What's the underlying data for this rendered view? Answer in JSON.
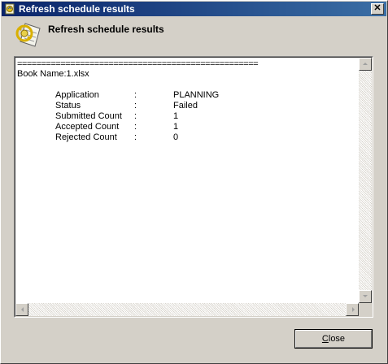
{
  "window": {
    "title": "Refresh schedule results",
    "close_glyph": "✕"
  },
  "header": {
    "title": "Refresh schedule results",
    "icon": "refresh-document-icon"
  },
  "results": {
    "separator": "==================================================",
    "book_line": "Book Name:1.xlsx",
    "rows": [
      {
        "label": "Application",
        "colon": ":",
        "value": "PLANNING"
      },
      {
        "label": "Status",
        "colon": ":",
        "value": "Failed"
      },
      {
        "label": "Submitted Count",
        "colon": ":",
        "value": "1"
      },
      {
        "label": "Accepted Count",
        "colon": ":",
        "value": "1"
      },
      {
        "label": "Rejected Count",
        "colon": ":",
        "value": "0"
      }
    ]
  },
  "buttons": {
    "close_first": "C",
    "close_rest": "lose"
  },
  "colors": {
    "titlebar_start": "#0a246a",
    "titlebar_end": "#3a6ea5",
    "face": "#d4d0c8"
  }
}
